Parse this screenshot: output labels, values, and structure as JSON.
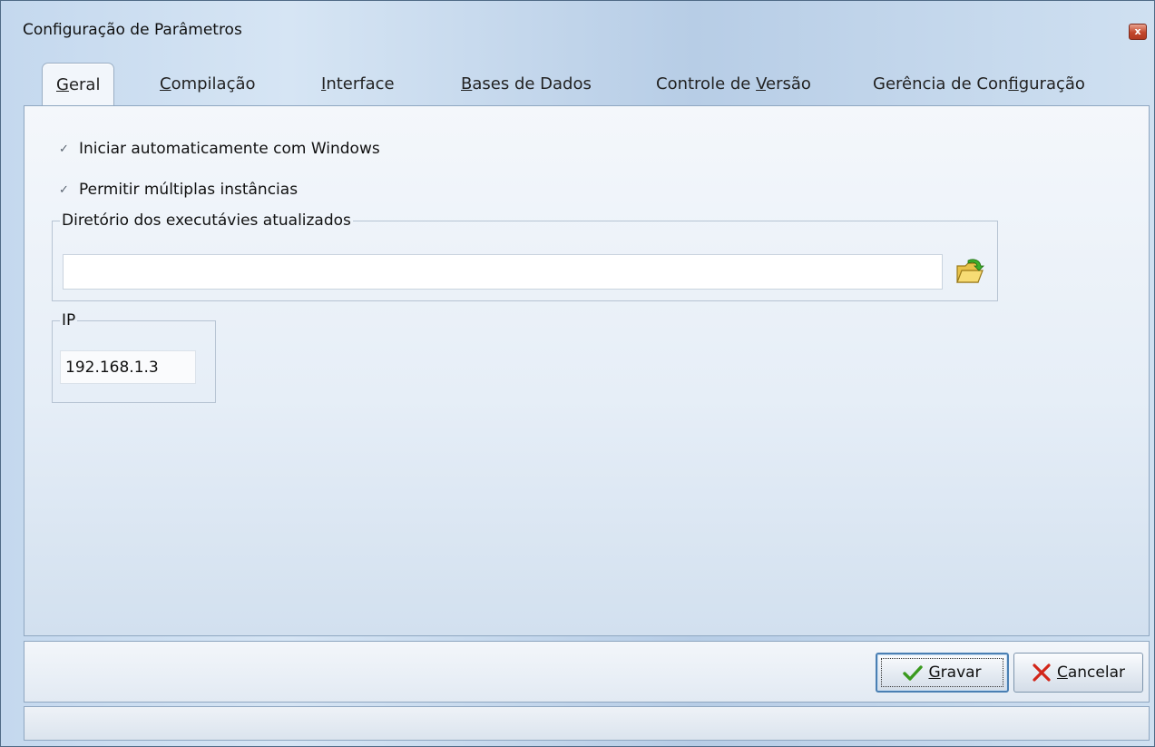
{
  "window": {
    "title": "Configuração de Parâmetros",
    "close_glyph": "x"
  },
  "tabs": [
    {
      "pre": "",
      "u": "G",
      "post": "eral",
      "active": true
    },
    {
      "pre": "",
      "u": "C",
      "post": "ompilação",
      "active": false
    },
    {
      "pre": "",
      "u": "I",
      "post": "nterface",
      "active": false
    },
    {
      "pre": "",
      "u": "B",
      "post": "ases de Dados",
      "active": false
    },
    {
      "pre": "Controle de ",
      "u": "V",
      "post": "ersão",
      "active": false
    },
    {
      "pre": "Gerência de Con",
      "u": "f",
      "post": "iguração",
      "active": false
    }
  ],
  "general": {
    "auto_start": {
      "label": "Iniciar automaticamente com Windows",
      "checked": true,
      "mark": "✓"
    },
    "multi_instance": {
      "label": "Permitir múltiplas instâncias",
      "checked": true,
      "mark": "✓"
    },
    "directory": {
      "legend": "Diretório dos executávies atualizados",
      "value": "",
      "icon": "folder-open-icon"
    },
    "ip": {
      "legend": "IP",
      "value": "192.168.1.3"
    }
  },
  "buttons": {
    "save": {
      "u": "G",
      "post": "ravar",
      "icon": "checkmark-icon"
    },
    "cancel": {
      "u": "C",
      "post": "ancelar",
      "icon": "x-icon"
    }
  },
  "colors": {
    "accent": "#4a7fb3",
    "check_green": "#3a9a1e",
    "cancel_red": "#d2261a"
  }
}
